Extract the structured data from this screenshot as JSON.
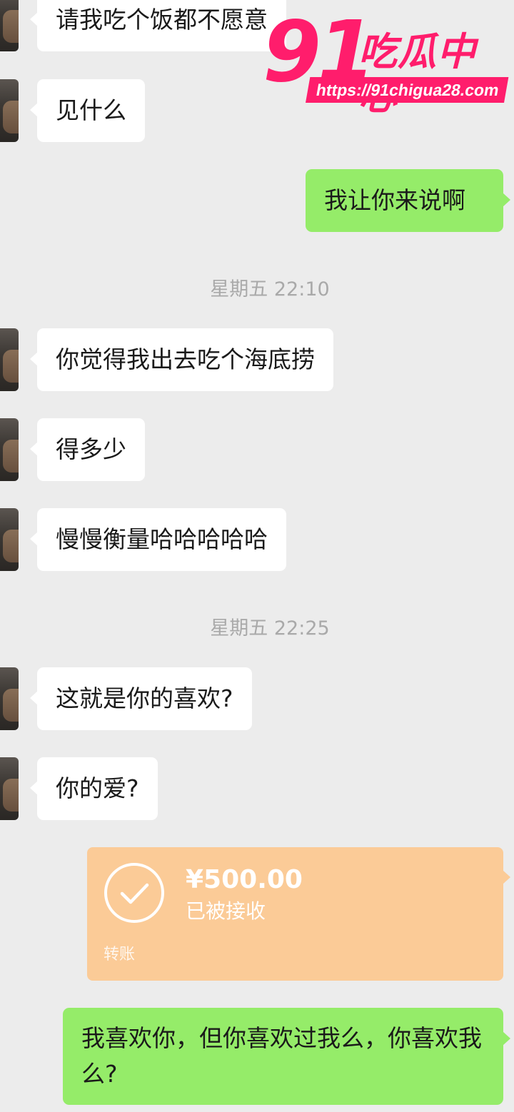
{
  "messages": [
    {
      "side": "in",
      "text": "请我吃个饭都不愿意"
    },
    {
      "side": "in",
      "text": "见什么"
    },
    {
      "side": "out",
      "text": "我让你来说啊"
    },
    {
      "side": "in",
      "text": "你觉得我出去吃个海底捞"
    },
    {
      "side": "in",
      "text": "得多少"
    },
    {
      "side": "in",
      "text": "慢慢衡量哈哈哈哈哈"
    },
    {
      "side": "in",
      "text": "这就是你的喜欢?"
    },
    {
      "side": "in",
      "text": "你的爱?"
    },
    {
      "side": "out",
      "text": "我喜欢你，但你喜欢过我么，你喜欢我么?"
    }
  ],
  "timestamps": [
    "星期五 22:10",
    "星期五 22:25"
  ],
  "transfer": {
    "amount": "¥500.00",
    "status": "已被接收",
    "kind": "转账",
    "color": "#fbcb97"
  },
  "watermark": {
    "number": "91",
    "brand": "吃瓜中心",
    "url": "https://91chigua28.com",
    "color": "#ff1d6c"
  },
  "colors": {
    "background": "#ececec",
    "incoming_bubble": "#ffffff",
    "outgoing_bubble": "#95ec69",
    "timestamp_text": "#a9a9a9"
  }
}
